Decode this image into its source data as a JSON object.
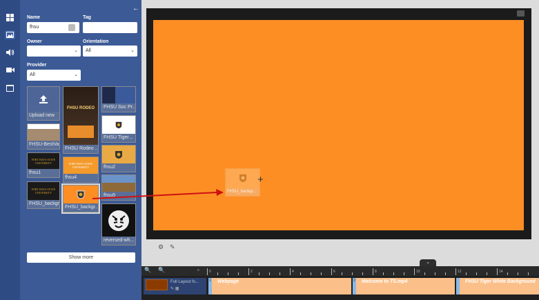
{
  "rail": {
    "items": [
      {
        "icon": "grid-icon",
        "label": ""
      },
      {
        "icon": "image-icon",
        "label": ""
      },
      {
        "icon": "audio-icon",
        "label": ""
      },
      {
        "icon": "video-icon",
        "label": ""
      },
      {
        "icon": "layout-icon",
        "label": ""
      }
    ]
  },
  "filters": {
    "name_label": "Name",
    "name_value": "fhsu",
    "tag_label": "Tag",
    "tag_value": "",
    "owner_label": "Owner",
    "owner_value": "",
    "orientation_label": "Orientation",
    "orientation_value": "All",
    "provider_label": "Provider",
    "provider_value": "All"
  },
  "media": {
    "upload_label": "Upload new",
    "tiles": [
      {
        "caption": "Upload new"
      },
      {
        "caption": "FHSU-BestVa..."
      },
      {
        "caption": "fhsu1"
      },
      {
        "caption": "FHSU_backgr..."
      },
      {
        "caption": "FHSU Rodeo ..."
      },
      {
        "caption": "fhsu4"
      },
      {
        "caption": "FHSU_backgr..."
      },
      {
        "caption": "FHSU Soc Pr..."
      },
      {
        "caption": "FHSU Tiger..."
      },
      {
        "caption": "fhsu2"
      },
      {
        "caption": "fhsu5"
      },
      {
        "caption": "reversed-wh..."
      }
    ],
    "rodeo_title": "FHSU RODEO",
    "fort_hays_text": "FORT HAYS STATE UNIVERSITY",
    "show_more": "Show more"
  },
  "stage": {
    "drag_ghost_caption": "FHSU_backgr..."
  },
  "timeline": {
    "track_name": "Full Layout fo...",
    "ticks": [
      "0",
      "2",
      "4",
      "6",
      "8",
      "10",
      "12",
      "14"
    ],
    "clips": [
      {
        "label": "Webpage",
        "num": "1"
      },
      {
        "label": "Welcome to TS.mp4",
        "num": "2"
      },
      {
        "label": "FHSU Tiger White Background",
        "num": "3"
      }
    ]
  },
  "colors": {
    "canvas_background": "#fd8e24",
    "panel": "#3c5a96",
    "rail": "#2f4b84",
    "drag_arrow": "#cc1111"
  }
}
